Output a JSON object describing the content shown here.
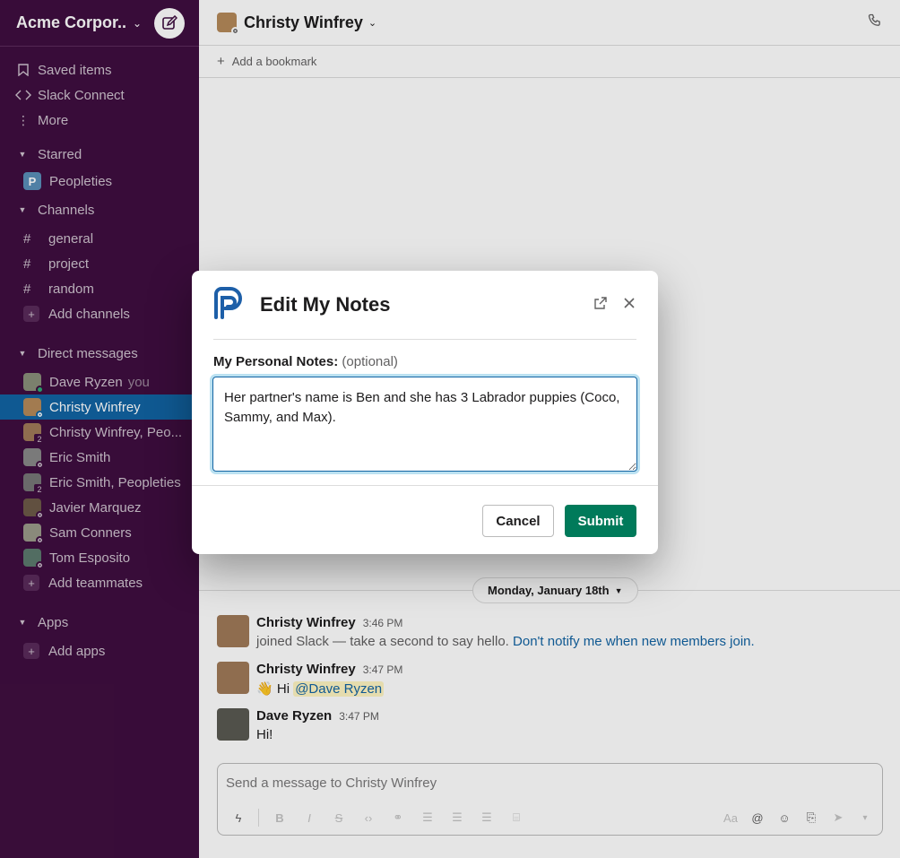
{
  "workspace": {
    "name": "Acme Corpor..."
  },
  "sidebar": {
    "top_items": [
      {
        "label": "Saved items",
        "icon": "bookmark-icon"
      },
      {
        "label": "Slack Connect",
        "icon": "slack-connect-icon"
      },
      {
        "label": "More",
        "icon": "more-vertical-icon"
      }
    ],
    "starred": {
      "label": "Starred",
      "items": [
        {
          "label": "Peopleties"
        }
      ]
    },
    "channels": {
      "label": "Channels",
      "items": [
        {
          "label": "general"
        },
        {
          "label": "project"
        },
        {
          "label": "random"
        }
      ],
      "add_label": "Add channels"
    },
    "dms": {
      "label": "Direct messages",
      "you_label": "you",
      "items": [
        {
          "label": "Dave Ryzen"
        },
        {
          "label": "Christy Winfrey"
        },
        {
          "label": "Christy Winfrey, Peo...",
          "count": "2"
        },
        {
          "label": "Eric Smith"
        },
        {
          "label": "Eric Smith, Peopleties",
          "count": "2"
        },
        {
          "label": "Javier Marquez"
        },
        {
          "label": "Sam Conners"
        },
        {
          "label": "Tom Esposito"
        }
      ],
      "add_label": "Add teammates"
    },
    "apps": {
      "label": "Apps",
      "add_label": "Add apps"
    }
  },
  "channel": {
    "title": "Christy Winfrey",
    "bookmark_label": "Add a bookmark"
  },
  "date_divider": "Monday, January 18th",
  "messages": [
    {
      "author": "Christy Winfrey",
      "time": "3:46 PM",
      "text": "joined Slack — take a second to say hello.",
      "link": "Don't notify me when new members join."
    },
    {
      "author": "Christy Winfrey",
      "time": "3:47 PM",
      "emoji": "👋",
      "text": "Hi",
      "mention": "@Dave Ryzen"
    },
    {
      "author": "Dave Ryzen",
      "time": "3:47 PM",
      "text": "Hi!"
    }
  ],
  "composer": {
    "placeholder": "Send a message to Christy Winfrey"
  },
  "modal": {
    "title": "Edit My Notes",
    "label": "My Personal Notes:",
    "label_optional": "(optional)",
    "notes_value": "Her partner's name is Ben and she has 3 Labrador puppies (Coco, Sammy, and Max).",
    "cancel_label": "Cancel",
    "submit_label": "Submit"
  },
  "colors": {
    "sidebar": "#3f0e40",
    "active": "#1164a3",
    "submit": "#007a5a",
    "link": "#1264a3",
    "brand": "#1d5fa8"
  }
}
